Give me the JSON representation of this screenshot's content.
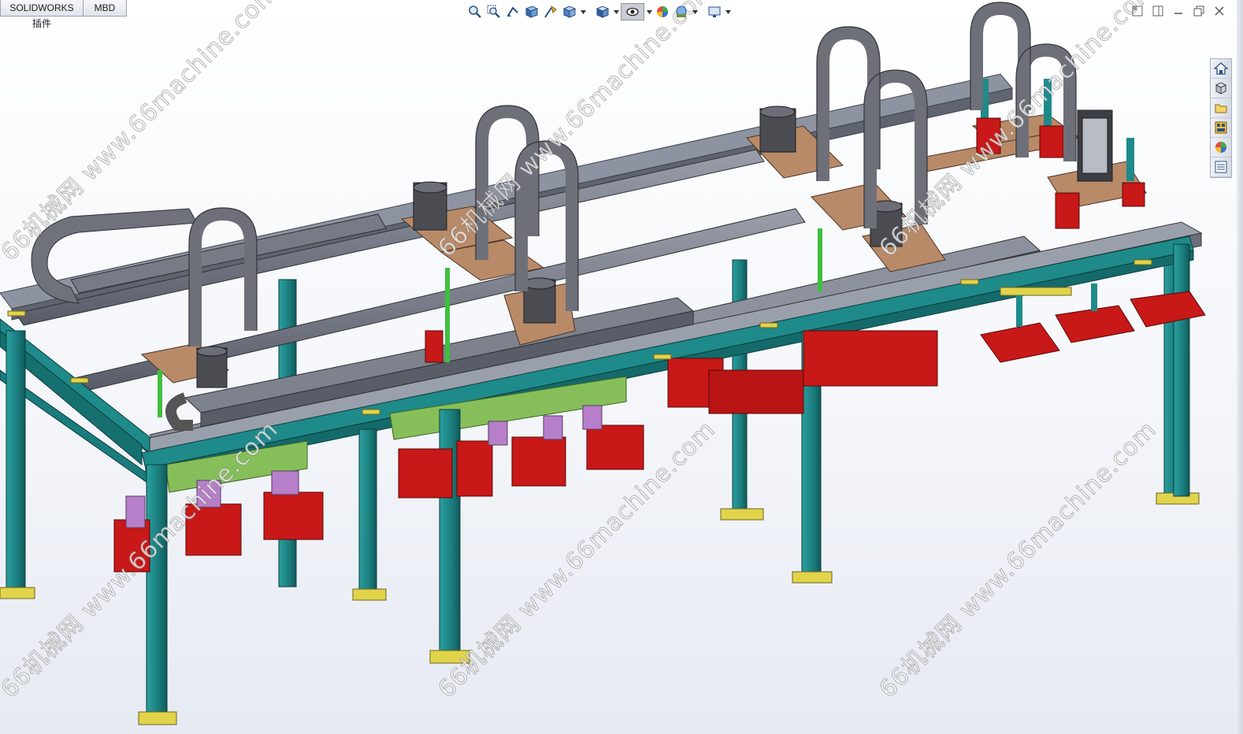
{
  "tabs": [
    {
      "label": "SOLIDWORKS 插件"
    },
    {
      "label": "MBD"
    }
  ],
  "hud_icons": [
    "zoom-to-fit-icon",
    "zoom-to-area-icon",
    "previous-view-icon",
    "section-view-icon",
    "dynamic-annotation-icon",
    "view-orientation-icon",
    "display-style-icon",
    "hide-show-items-icon",
    "edit-appearance-icon",
    "apply-scene-icon",
    "view-settings-icon"
  ],
  "window_controls": [
    "restore-pane-icon",
    "split-pane-icon",
    "minimize-icon",
    "restore-icon",
    "close-icon"
  ],
  "task_pane": [
    "home-icon",
    "design-library-icon",
    "file-explorer-icon",
    "view-palette-icon",
    "appearances-icon",
    "custom-properties-icon"
  ],
  "watermark": {
    "text": "66机械网  www.66machine.com"
  },
  "colors": {
    "frame": "#1f8a8a",
    "frame_dark": "#146a6a",
    "rail": "#7a7f8c",
    "rail_dark": "#4d5260",
    "plate": "#b98a68",
    "gripper": "#c81818",
    "gripper_dark": "#8a0d0d",
    "cable_chain": "#6e7079",
    "motor": "#4a4c52",
    "foot": "#e2d44a",
    "green_plate": "#86bf5a",
    "violet": "#b77fc9"
  }
}
